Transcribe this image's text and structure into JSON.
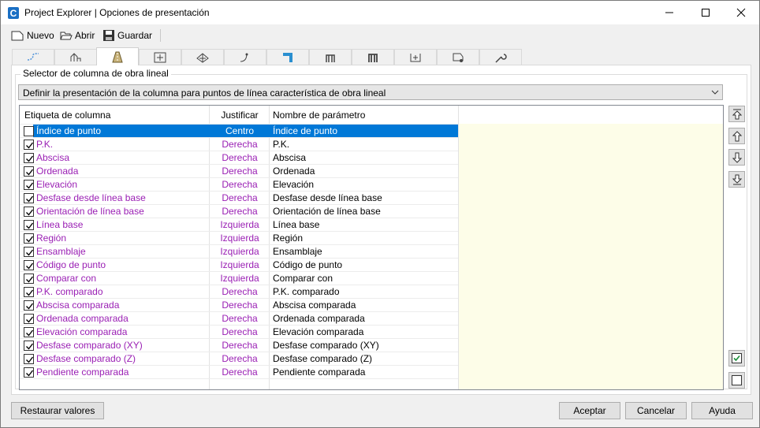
{
  "window": {
    "title": "Project Explorer | Opciones de presentación",
    "min_glyph": "—",
    "max_glyph": "☐",
    "close_glyph": "✕"
  },
  "toolbar": {
    "new_label": "Nuevo",
    "open_label": "Abrir",
    "save_label": "Guardar"
  },
  "tabs": [
    "alignment-tab",
    "profile-tab",
    "corridor-tab",
    "sample-lines-tab",
    "surface-tab",
    "feature-line-tab",
    "pipe-network-tab",
    "pressure-network-tab",
    "assembly-tab",
    "points-tab",
    "parcel-tab",
    "settings-tab"
  ],
  "active_tab_index": 2,
  "group": {
    "title": "Selector de columna de obra lineal",
    "selector_value": "Definir la presentación de la columna para puntos de línea característica de obra lineal"
  },
  "grid": {
    "headers": {
      "label": "Etiqueta de columna",
      "justify": "Justificar",
      "param": "Nombre de parámetro"
    },
    "rows": [
      {
        "checked": false,
        "label": "Índice de punto",
        "justify": "Centro",
        "param": "Índice de punto",
        "selected": true
      },
      {
        "checked": true,
        "label": "P.K.",
        "justify": "Derecha",
        "param": "P.K."
      },
      {
        "checked": true,
        "label": "Abscisa",
        "justify": "Derecha",
        "param": "Abscisa"
      },
      {
        "checked": true,
        "label": "Ordenada",
        "justify": "Derecha",
        "param": "Ordenada"
      },
      {
        "checked": true,
        "label": "Elevación",
        "justify": "Derecha",
        "param": "Elevación"
      },
      {
        "checked": true,
        "label": "Desfase desde línea base",
        "justify": "Derecha",
        "param": "Desfase desde línea base"
      },
      {
        "checked": true,
        "label": "Orientación de línea base",
        "justify": "Derecha",
        "param": "Orientación de línea base"
      },
      {
        "checked": true,
        "label": "Línea base",
        "justify": "Izquierda",
        "param": "Línea base"
      },
      {
        "checked": true,
        "label": "Región",
        "justify": "Izquierda",
        "param": "Región"
      },
      {
        "checked": true,
        "label": "Ensamblaje",
        "justify": "Izquierda",
        "param": "Ensamblaje"
      },
      {
        "checked": true,
        "label": "Código de punto",
        "justify": "Izquierda",
        "param": "Código de punto"
      },
      {
        "checked": true,
        "label": "Comparar con",
        "justify": "Izquierda",
        "param": "Comparar con"
      },
      {
        "checked": true,
        "label": "P.K. comparado",
        "justify": "Derecha",
        "param": "P.K. comparado"
      },
      {
        "checked": true,
        "label": "Abscisa comparada",
        "justify": "Derecha",
        "param": "Abscisa comparada"
      },
      {
        "checked": true,
        "label": "Ordenada comparada",
        "justify": "Derecha",
        "param": "Ordenada comparada"
      },
      {
        "checked": true,
        "label": "Elevación comparada",
        "justify": "Derecha",
        "param": "Elevación comparada"
      },
      {
        "checked": true,
        "label": "Desfase comparado (XY)",
        "justify": "Derecha",
        "param": "Desfase comparado (XY)"
      },
      {
        "checked": true,
        "label": "Desfase comparado (Z)",
        "justify": "Derecha",
        "param": "Desfase comparado (Z)"
      },
      {
        "checked": true,
        "label": "Pendiente comparada",
        "justify": "Derecha",
        "param": "Pendiente comparada"
      }
    ]
  },
  "colors": {
    "accent": "#0078d7",
    "label_text": "#9a1fb4",
    "grid_empty_bg": "#fdfde8"
  },
  "buttons": {
    "restore": "Restaurar valores",
    "accept": "Aceptar",
    "cancel": "Cancelar",
    "help": "Ayuda"
  }
}
